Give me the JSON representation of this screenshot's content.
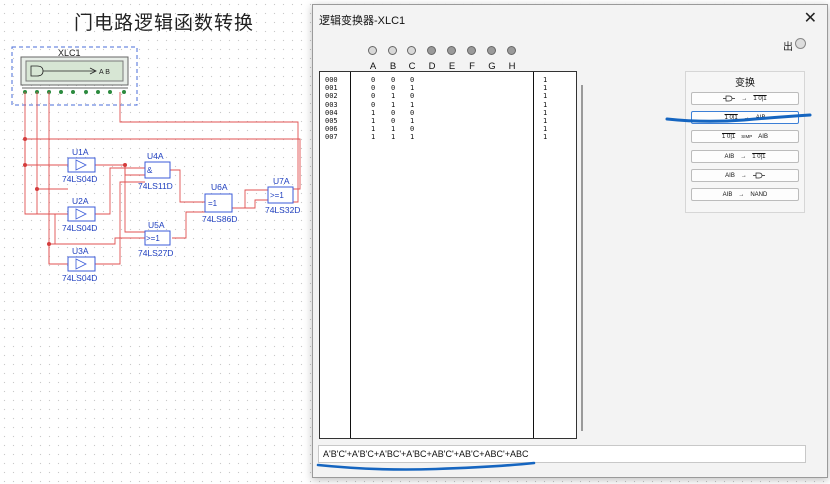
{
  "canvas_title": "门电路逻辑函数转换",
  "schematic": {
    "analyzer_label": "XLC1",
    "analyzer_display": "A B",
    "gates": [
      {
        "ref": "U1A",
        "part": "74LS04D",
        "sym": ""
      },
      {
        "ref": "U2A",
        "part": "74LS04D",
        "sym": ""
      },
      {
        "ref": "U3A",
        "part": "74LS04D",
        "sym": ""
      },
      {
        "ref": "U4A",
        "part": "74LS11D",
        "sym": "&"
      },
      {
        "ref": "U5A",
        "part": "74LS27D",
        "sym": ">=1"
      },
      {
        "ref": "U6A",
        "part": "74LS86D",
        "sym": "=1"
      },
      {
        "ref": "U7A",
        "part": "74LS32D",
        "sym": ">=1"
      }
    ]
  },
  "dialog": {
    "title": "逻辑变换器-XLC1",
    "close_glyph": "✕",
    "out_label": "出",
    "columns": [
      "A",
      "B",
      "C",
      "D",
      "E",
      "F",
      "G",
      "H"
    ],
    "rows": [
      {
        "idx": "000",
        "a": "0",
        "b": "0",
        "c": "0",
        "out": "1"
      },
      {
        "idx": "001",
        "a": "0",
        "b": "0",
        "c": "1",
        "out": "1"
      },
      {
        "idx": "002",
        "a": "0",
        "b": "1",
        "c": "0",
        "out": "1"
      },
      {
        "idx": "003",
        "a": "0",
        "b": "1",
        "c": "1",
        "out": "1"
      },
      {
        "idx": "004",
        "a": "1",
        "b": "0",
        "c": "0",
        "out": "1"
      },
      {
        "idx": "005",
        "a": "1",
        "b": "0",
        "c": "1",
        "out": "1"
      },
      {
        "idx": "006",
        "a": "1",
        "b": "1",
        "c": "0",
        "out": "1"
      },
      {
        "idx": "007",
        "a": "1",
        "b": "1",
        "c": "1",
        "out": "1"
      }
    ],
    "convert_title": "变换",
    "buttons": [
      {
        "left": "",
        "arrow": "→",
        "right": "1 0|1"
      },
      {
        "left": "1 0|1",
        "arrow": "→",
        "right": "AIB"
      },
      {
        "left": "1 0|1",
        "arrow": "SIMP",
        "right": "AIB"
      },
      {
        "left": "AIB",
        "arrow": "→",
        "right": "1 0|1"
      },
      {
        "left": "AIB",
        "arrow": "→",
        "right": ""
      },
      {
        "left": "AIB",
        "arrow": "→",
        "right": "NAND"
      }
    ],
    "expression": "A'B'C'+A'B'C+A'BC'+A'BC+AB'C'+AB'C+ABC'+ABC"
  },
  "annotations": {
    "color": "#1565c0"
  }
}
